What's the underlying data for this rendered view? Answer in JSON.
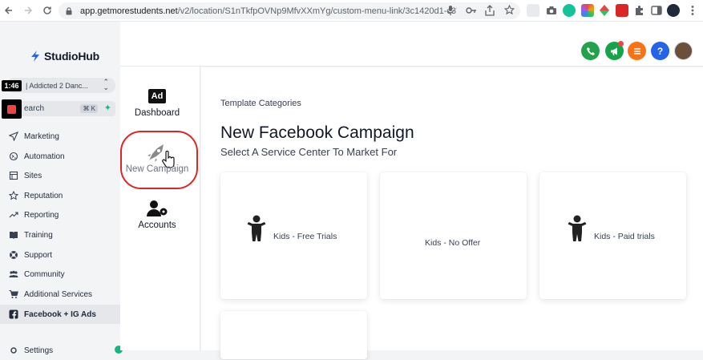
{
  "browser": {
    "url_host": "app.getmorestudents.net",
    "url_path": "/v2/location/S1nTkfpOVNp9MfvXXmYg/custom-menu-link/3c1420d1-c378-..."
  },
  "recording": {
    "time": "1:46"
  },
  "sidebar": {
    "brand": "StudioHub",
    "location_select": "| Addicted 2 Danc...",
    "search_placeholder": "earch",
    "search_shortcut": "⌘ K",
    "items": [
      {
        "label": "Marketing",
        "icon": "send-icon"
      },
      {
        "label": "Automation",
        "icon": "automation-icon"
      },
      {
        "label": "Sites",
        "icon": "sites-icon"
      },
      {
        "label": "Reputation",
        "icon": "star-icon"
      },
      {
        "label": "Reporting",
        "icon": "trend-icon"
      },
      {
        "label": "Training",
        "icon": "book-icon"
      },
      {
        "label": "Support",
        "icon": "lifebuoy-icon"
      },
      {
        "label": "Community",
        "icon": "community-icon"
      },
      {
        "label": "Additional Services",
        "icon": "cart-icon"
      },
      {
        "label": "Facebook + IG Ads",
        "icon": "facebook-icon"
      }
    ],
    "partial_item": "Settings"
  },
  "submenu": {
    "dashboard_label": "Dashboard",
    "dashboard_icon_text": "Ad",
    "new_campaign_label": "New Campaign",
    "accounts_label": "Accounts"
  },
  "main": {
    "category_title": "Template Categories",
    "title": "New Facebook Campaign",
    "subtitle": "Select A Service Center To Market For",
    "cards": [
      {
        "label": "Kids - Free Trials",
        "icon": "child-icon"
      },
      {
        "label": "Kids - No Offer"
      },
      {
        "label": "Kids - Paid trials",
        "icon": "child-icon"
      }
    ]
  },
  "colors": {
    "phone": "#22a24a",
    "announce": "#16a34a",
    "tasks": "#f97316",
    "help": "#2563eb",
    "highlight": "#dc2626"
  }
}
